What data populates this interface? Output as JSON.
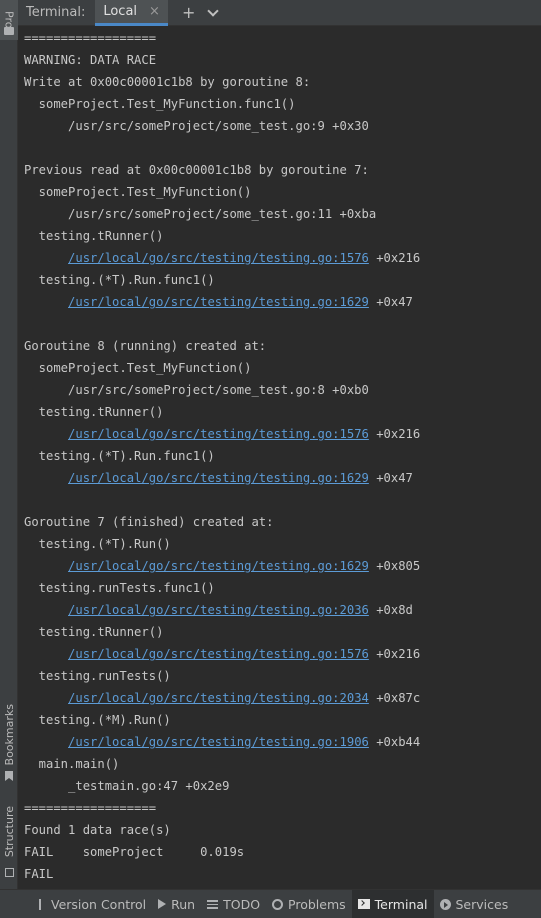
{
  "side_tabs": {
    "project": "Pro",
    "bookmarks": "Bookmarks",
    "structure": "Structure"
  },
  "header": {
    "title": "Terminal:",
    "tab_label": "Local",
    "close_glyph": "×",
    "add_glyph": "+"
  },
  "terminal": {
    "lines": [
      {
        "text": "==================",
        "link": "",
        "suffix": ""
      },
      {
        "text": "WARNING: DATA RACE",
        "link": "",
        "suffix": ""
      },
      {
        "text": "Write at 0x00c00001c1b8 by goroutine 8:",
        "link": "",
        "suffix": ""
      },
      {
        "text": "  someProject.Test_MyFunction.func1()",
        "link": "",
        "suffix": ""
      },
      {
        "text": "      /usr/src/someProject/some_test.go:9 +0x30",
        "link": "",
        "suffix": ""
      },
      {
        "text": "",
        "link": "",
        "suffix": ""
      },
      {
        "text": "Previous read at 0x00c00001c1b8 by goroutine 7:",
        "link": "",
        "suffix": ""
      },
      {
        "text": "  someProject.Test_MyFunction()",
        "link": "",
        "suffix": ""
      },
      {
        "text": "      /usr/src/someProject/some_test.go:11 +0xba",
        "link": "",
        "suffix": ""
      },
      {
        "text": "  testing.tRunner()",
        "link": "",
        "suffix": ""
      },
      {
        "text": "      ",
        "link": "/usr/local/go/src/testing/testing.go:1576",
        "suffix": " +0x216"
      },
      {
        "text": "  testing.(*T).Run.func1()",
        "link": "",
        "suffix": ""
      },
      {
        "text": "      ",
        "link": "/usr/local/go/src/testing/testing.go:1629",
        "suffix": " +0x47"
      },
      {
        "text": "",
        "link": "",
        "suffix": ""
      },
      {
        "text": "Goroutine 8 (running) created at:",
        "link": "",
        "suffix": ""
      },
      {
        "text": "  someProject.Test_MyFunction()",
        "link": "",
        "suffix": ""
      },
      {
        "text": "      /usr/src/someProject/some_test.go:8 +0xb0",
        "link": "",
        "suffix": ""
      },
      {
        "text": "  testing.tRunner()",
        "link": "",
        "suffix": ""
      },
      {
        "text": "      ",
        "link": "/usr/local/go/src/testing/testing.go:1576",
        "suffix": " +0x216"
      },
      {
        "text": "  testing.(*T).Run.func1()",
        "link": "",
        "suffix": ""
      },
      {
        "text": "      ",
        "link": "/usr/local/go/src/testing/testing.go:1629",
        "suffix": " +0x47"
      },
      {
        "text": "",
        "link": "",
        "suffix": ""
      },
      {
        "text": "Goroutine 7 (finished) created at:",
        "link": "",
        "suffix": ""
      },
      {
        "text": "  testing.(*T).Run()",
        "link": "",
        "suffix": ""
      },
      {
        "text": "      ",
        "link": "/usr/local/go/src/testing/testing.go:1629",
        "suffix": " +0x805"
      },
      {
        "text": "  testing.runTests.func1()",
        "link": "",
        "suffix": ""
      },
      {
        "text": "      ",
        "link": "/usr/local/go/src/testing/testing.go:2036",
        "suffix": " +0x8d"
      },
      {
        "text": "  testing.tRunner()",
        "link": "",
        "suffix": ""
      },
      {
        "text": "      ",
        "link": "/usr/local/go/src/testing/testing.go:1576",
        "suffix": " +0x216"
      },
      {
        "text": "  testing.runTests()",
        "link": "",
        "suffix": ""
      },
      {
        "text": "      ",
        "link": "/usr/local/go/src/testing/testing.go:2034",
        "suffix": " +0x87c"
      },
      {
        "text": "  testing.(*M).Run()",
        "link": "",
        "suffix": ""
      },
      {
        "text": "      ",
        "link": "/usr/local/go/src/testing/testing.go:1906",
        "suffix": " +0xb44"
      },
      {
        "text": "  main.main()",
        "link": "",
        "suffix": ""
      },
      {
        "text": "      _testmain.go:47 +0x2e9",
        "link": "",
        "suffix": ""
      },
      {
        "text": "==================",
        "link": "",
        "suffix": ""
      },
      {
        "text": "Found 1 data race(s)",
        "link": "",
        "suffix": ""
      },
      {
        "text": "FAIL    someProject     0.019s",
        "link": "",
        "suffix": ""
      },
      {
        "text": "FAIL",
        "link": "",
        "suffix": ""
      }
    ]
  },
  "bottom_bar": {
    "version_control": "Version Control",
    "run": "Run",
    "todo": "TODO",
    "problems": "Problems",
    "terminal": "Terminal",
    "services": "Services"
  },
  "colors": {
    "background": "#2b2b2b",
    "panel": "#3c3f41",
    "link": "#5c9bd6",
    "text": "#c8c8c8",
    "active_tab_underline": "#4a88c7"
  }
}
